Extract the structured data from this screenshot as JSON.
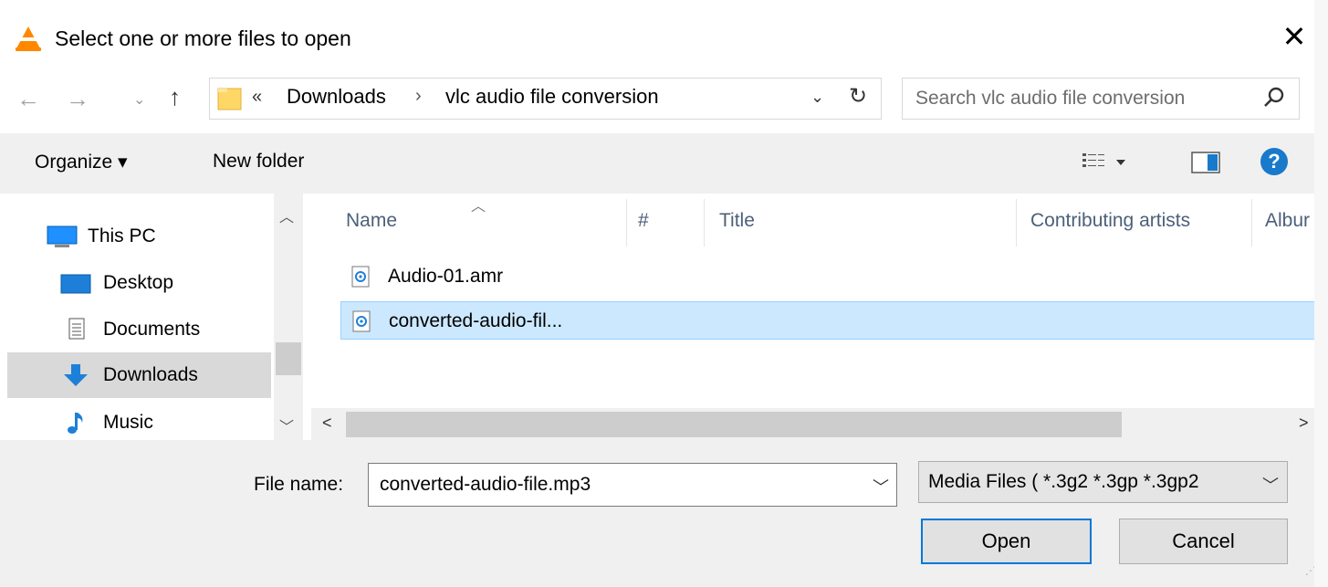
{
  "window": {
    "title": "Select one or more files to open",
    "close_glyph": "✕"
  },
  "nav": {
    "back_glyph": "←",
    "forward_glyph": "→",
    "recent_glyph": "⌄",
    "up_glyph": "↑"
  },
  "address": {
    "chevron": "«",
    "path": [
      "Downloads",
      "vlc audio file conversion"
    ],
    "separator": "›",
    "dropdown_glyph": "⌄",
    "refresh_glyph": "↻"
  },
  "search": {
    "placeholder": "Search vlc audio file conversion"
  },
  "toolbar": {
    "organize_label": "Organize ▾",
    "new_folder_label": "New folder",
    "help_label": "?"
  },
  "nav_pane": {
    "items": [
      {
        "label": "This PC",
        "icon": "computer-icon"
      },
      {
        "label": "Desktop",
        "icon": "desktop-icon"
      },
      {
        "label": "Documents",
        "icon": "documents-icon"
      },
      {
        "label": "Downloads",
        "icon": "downloads-icon",
        "selected": true
      },
      {
        "label": "Music",
        "icon": "music-icon"
      }
    ]
  },
  "file_list": {
    "columns": [
      "Name",
      "#",
      "Title",
      "Contributing artists",
      "Albur"
    ],
    "sorted_by": "Name",
    "rows": [
      {
        "name": "Audio-01.amr",
        "selected": false
      },
      {
        "name": "converted-audio-fil...",
        "selected": true
      }
    ]
  },
  "footer": {
    "file_name_label": "File name:",
    "file_name_value": "converted-audio-file.mp3",
    "file_type": "Media Files ( *.3g2 *.3gp *.3gp2",
    "open_label": "Open",
    "cancel_label": "Cancel"
  },
  "colors": {
    "accent": "#0078d7",
    "selection": "#cce8ff",
    "toolbar_bg": "#f0f0f0"
  }
}
